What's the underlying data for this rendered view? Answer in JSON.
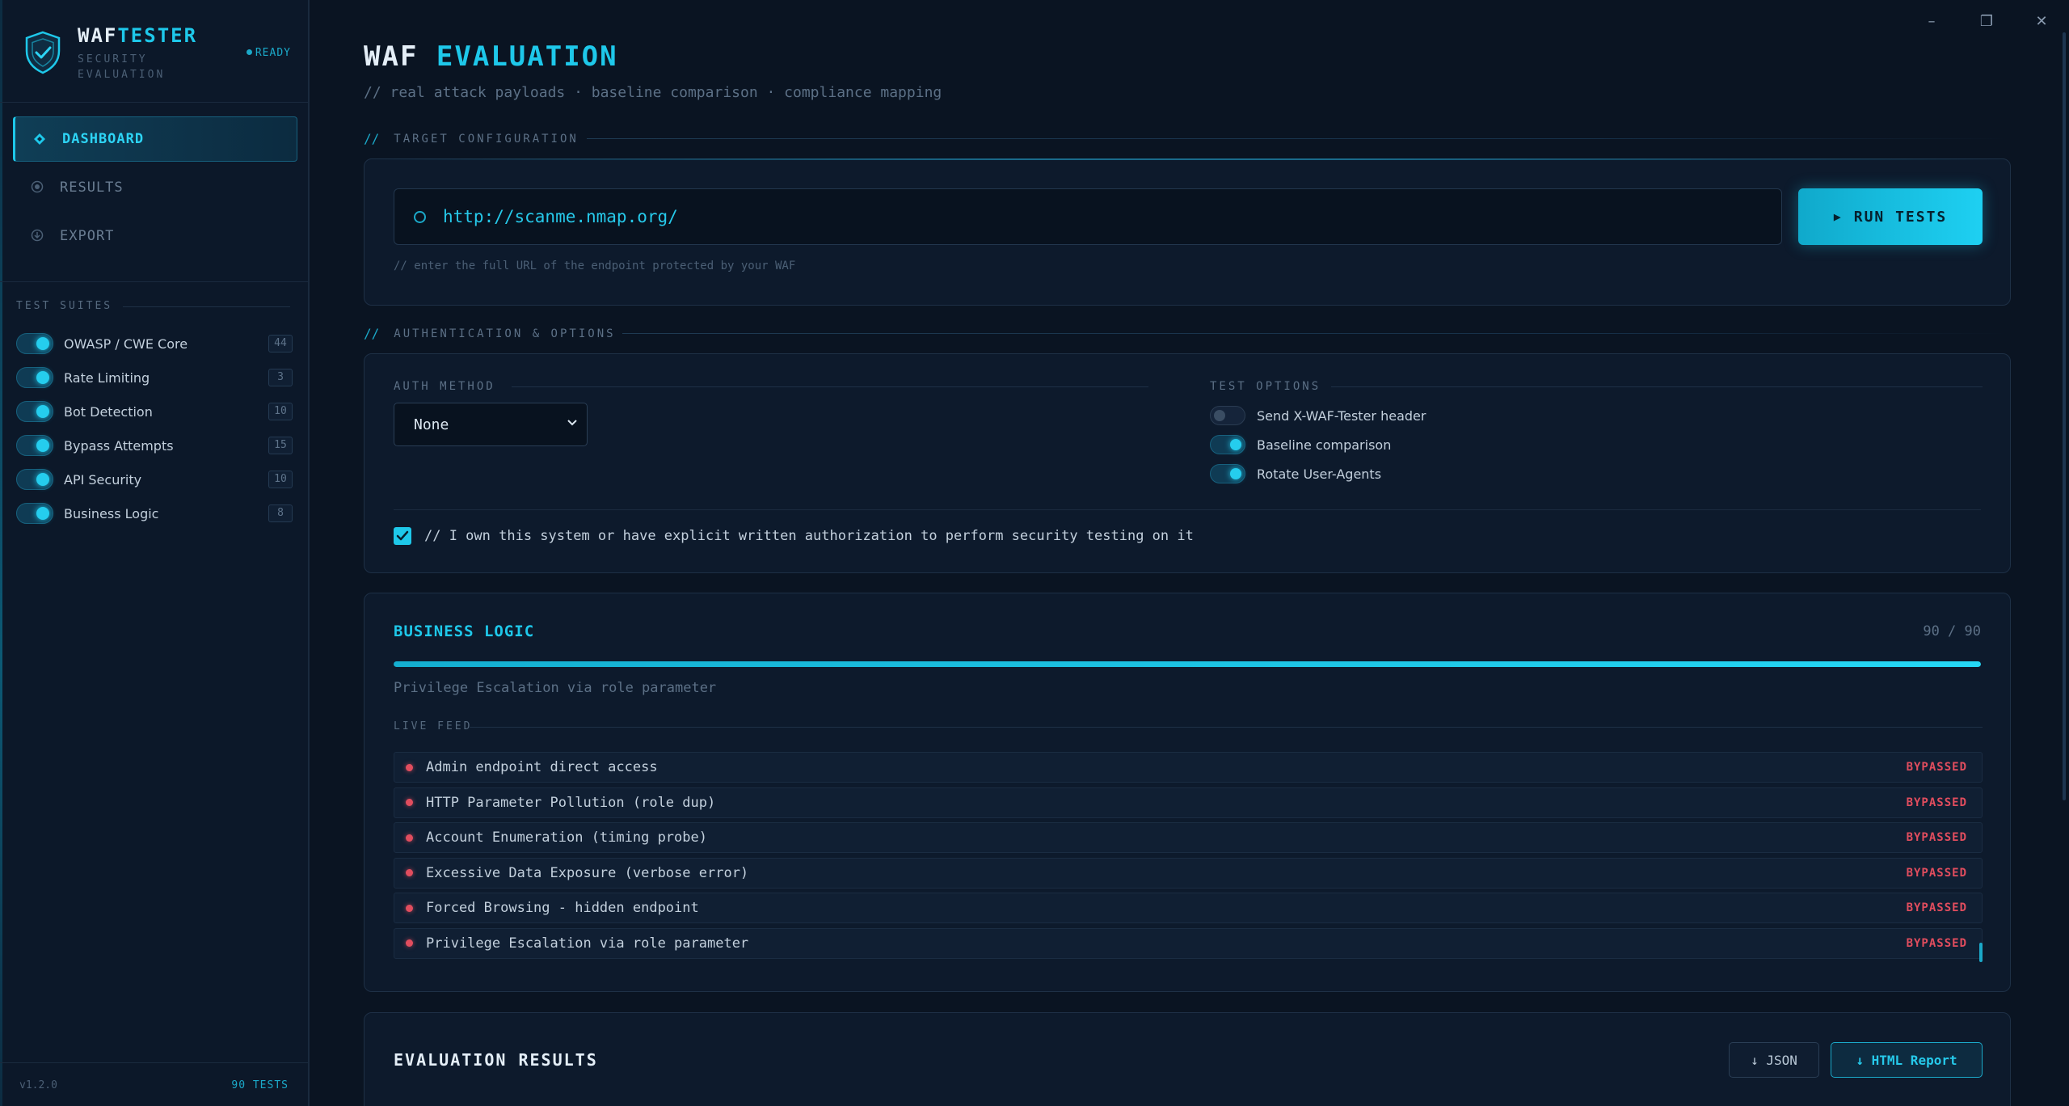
{
  "brand": {
    "name_a": "WAF",
    "name_b": "TESTER",
    "subtitle": "SECURITY EVALUATION",
    "status": "READY"
  },
  "nav": [
    {
      "label": "DASHBOARD",
      "icon": "diamond-icon",
      "active": true
    },
    {
      "label": "RESULTS",
      "icon": "target-icon",
      "active": false
    },
    {
      "label": "EXPORT",
      "icon": "download-circle-icon",
      "active": false
    }
  ],
  "suites": {
    "title": "TEST SUITES",
    "items": [
      {
        "label": "OWASP / CWE Core",
        "count": "44",
        "enabled": true
      },
      {
        "label": "Rate Limiting",
        "count": "3",
        "enabled": true
      },
      {
        "label": "Bot Detection",
        "count": "10",
        "enabled": true
      },
      {
        "label": "Bypass Attempts",
        "count": "15",
        "enabled": true
      },
      {
        "label": "API Security",
        "count": "10",
        "enabled": true
      },
      {
        "label": "Business Logic",
        "count": "8",
        "enabled": true
      }
    ]
  },
  "footer": {
    "version": "v1.2.0",
    "tests": "90 TESTS"
  },
  "window": {
    "minimize": "–",
    "restore": "❐",
    "close": "✕"
  },
  "header": {
    "title_a": "WAF",
    "title_b": "EVALUATION",
    "subtitle": "// real attack payloads · baseline comparison · compliance mapping"
  },
  "target": {
    "section_label": "TARGET CONFIGURATION",
    "section_prefix": "//",
    "url": "http://scanme.nmap.org/",
    "run_label": "RUN TESTS",
    "hint": "// enter the full URL of the endpoint protected by your WAF"
  },
  "auth": {
    "section_label": "AUTHENTICATION & OPTIONS",
    "section_prefix": "//",
    "method_label": "AUTH METHOD",
    "method_value": "None",
    "options_label": "TEST OPTIONS",
    "options": [
      {
        "label": "Send X-WAF-Tester header",
        "enabled": false
      },
      {
        "label": "Baseline comparison",
        "enabled": true
      },
      {
        "label": "Rotate User-Agents",
        "enabled": true
      }
    ],
    "consent_checked": true,
    "consent_text": "// I own this system or have explicit written authorization to perform security testing on it"
  },
  "progress": {
    "suite": "BUSINESS LOGIC",
    "count_text": "90 / 90",
    "fraction": 1.0,
    "current": "Privilege Escalation via role parameter",
    "feed_label": "LIVE FEED",
    "feed": [
      {
        "name": "Admin endpoint direct access",
        "status": "BYPASSED"
      },
      {
        "name": "HTTP Parameter Pollution (role dup)",
        "status": "BYPASSED"
      },
      {
        "name": "Account Enumeration (timing probe)",
        "status": "BYPASSED"
      },
      {
        "name": "Excessive Data Exposure (verbose error)",
        "status": "BYPASSED"
      },
      {
        "name": "Forced Browsing - hidden endpoint",
        "status": "BYPASSED"
      },
      {
        "name": "Privilege Escalation via role parameter",
        "status": "BYPASSED"
      }
    ]
  },
  "results": {
    "title": "EVALUATION RESULTS",
    "json_label": "↓ JSON",
    "html_label": "↓ HTML Report"
  },
  "colors": {
    "accent": "#1ec8ea",
    "danger": "#e14d5e",
    "bg": "#0a1422"
  }
}
